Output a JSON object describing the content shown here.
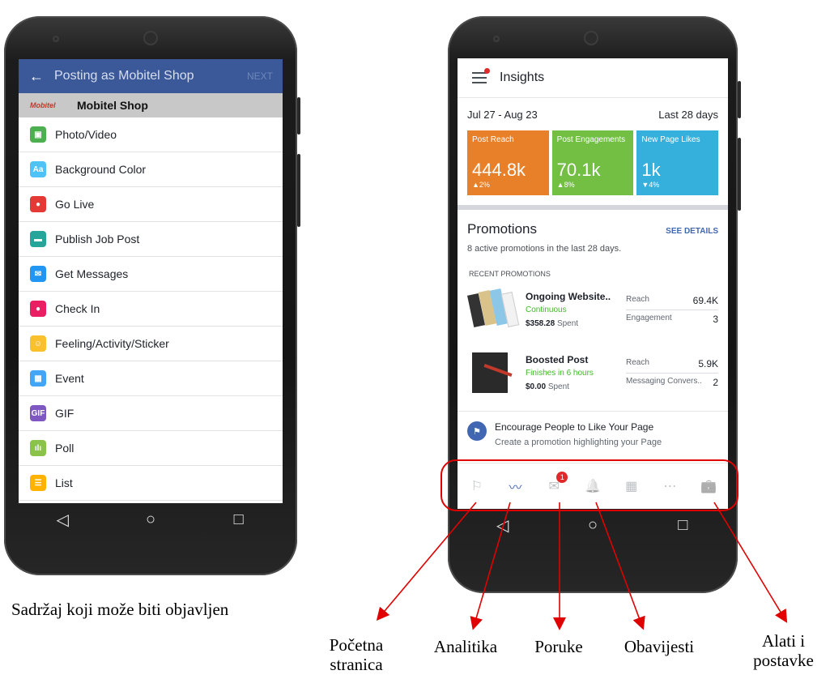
{
  "left_phone": {
    "header_back": "←",
    "header_title": "Posting as Mobitel Shop",
    "header_next": "NEXT",
    "page_logo_text": "Mobitel",
    "page_name": "Mobitel Shop",
    "items": [
      {
        "label": "Photo/Video",
        "icon": "photo-icon",
        "color": "#4caf50",
        "glyph": "▣"
      },
      {
        "label": "Background Color",
        "icon": "background-color-icon",
        "color": "#4fc3f7",
        "glyph": "Aa"
      },
      {
        "label": "Go Live",
        "icon": "live-video-icon",
        "color": "#e53935",
        "glyph": "●"
      },
      {
        "label": "Publish Job Post",
        "icon": "briefcase-icon",
        "color": "#26a69a",
        "glyph": "▬"
      },
      {
        "label": "Get Messages",
        "icon": "messenger-icon",
        "color": "#2196f3",
        "glyph": "✉"
      },
      {
        "label": "Check In",
        "icon": "location-pin-icon",
        "color": "#e91e63",
        "glyph": "●"
      },
      {
        "label": "Feeling/Activity/Sticker",
        "icon": "smiley-icon",
        "color": "#fbc02d",
        "glyph": "☺"
      },
      {
        "label": "Event",
        "icon": "calendar-icon",
        "color": "#42a5f5",
        "glyph": "▦"
      },
      {
        "label": "GIF",
        "icon": "gif-icon",
        "color": "#7e57c2",
        "glyph": "GIF"
      },
      {
        "label": "Poll",
        "icon": "poll-icon",
        "color": "#8bc34a",
        "glyph": "ılı"
      },
      {
        "label": "List",
        "icon": "list-icon",
        "color": "#ffb300",
        "glyph": "☰"
      }
    ],
    "nav": {
      "back": "◁",
      "home": "○",
      "recent": "□"
    }
  },
  "right_phone": {
    "title": "Insights",
    "date_range": "Jul 27 - Aug 23",
    "period": "Last 28 days",
    "tiles": [
      {
        "label": "Post Reach",
        "value": "444.8k",
        "change": "▲2%",
        "color": "#e8802a"
      },
      {
        "label": "Post Engagements",
        "value": "70.1k",
        "change": "▲8%",
        "color": "#72bf44"
      },
      {
        "label": "New Page Likes",
        "value": "1k",
        "change": "▼4%",
        "color": "#35b0dc"
      }
    ],
    "promotions_title": "Promotions",
    "see_details": "SEE DETAILS",
    "promotions_sub": "8 active promotions in the last 28 days.",
    "recent_label": "RECENT PROMOTIONS",
    "promotions": [
      {
        "name": "Ongoing Website..",
        "status": "Continuous",
        "amount": "$358.28",
        "spent": "Spent",
        "stat1_label": "Reach",
        "stat1_value": "69.4K",
        "stat2_label": "Engagement",
        "stat2_value": "3"
      },
      {
        "name": "Boosted Post",
        "status": "Finishes in 6 hours",
        "amount": "$0.00",
        "spent": "Spent",
        "stat1_label": "Reach",
        "stat1_value": "5.9K",
        "stat2_label": "Messaging Convers..",
        "stat2_value": "2"
      }
    ],
    "encourage_title": "Encourage People to Like Your Page",
    "encourage_sub": "Create a promotion highlighting your Page",
    "bottom_nav": {
      "home": "⚐",
      "insights": "〰",
      "messages": "✉",
      "notifications": "🔔",
      "pages": "▦",
      "more": "⋯",
      "tools": "💼",
      "badge": "1"
    },
    "nav": {
      "back": "◁",
      "home": "○",
      "recent": "□"
    }
  },
  "annotations": {
    "caption": "Sadržaj koji može biti objavljen",
    "home": "Početna stranica",
    "analytics": "Analitika",
    "messages": "Poruke",
    "notifications": "Obavijesti",
    "tools": "Alati i postavke",
    "highlight_color": "#e00000"
  }
}
